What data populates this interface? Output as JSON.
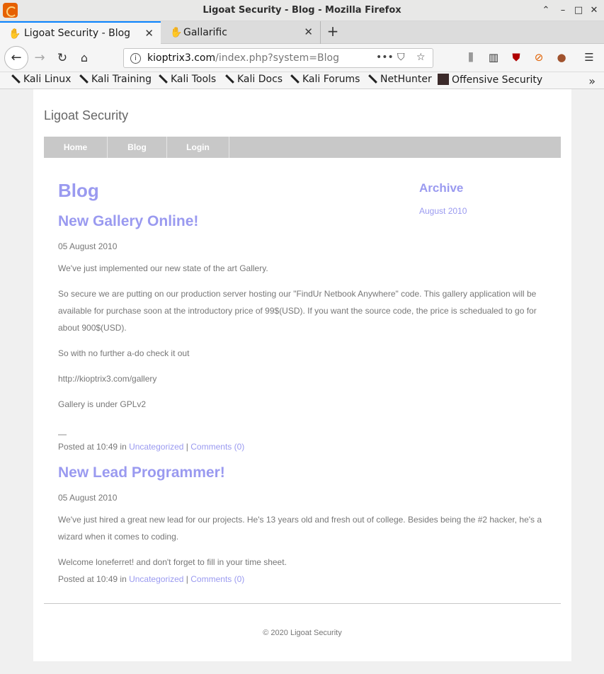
{
  "window": {
    "title": "Ligoat Security - Blog - Mozilla Firefox"
  },
  "tabs": [
    {
      "label": "Ligoat Security - Blog",
      "active": true
    },
    {
      "label": "Gallarific",
      "active": false
    }
  ],
  "urlbar": {
    "host": "kioptrix3.com",
    "path": "/index.php?system=Blog"
  },
  "bookmarks": [
    {
      "label": "Kali Linux"
    },
    {
      "label": "Kali Training"
    },
    {
      "label": "Kali Tools"
    },
    {
      "label": "Kali Docs"
    },
    {
      "label": "Kali Forums"
    },
    {
      "label": "NetHunter"
    },
    {
      "label": "Offensive Security"
    }
  ],
  "site": {
    "title": "Ligoat Security",
    "menu": [
      "Home",
      "Blog",
      "Login"
    ],
    "heading": "Blog",
    "archive_heading": "Archive",
    "archive_link": "August 2010",
    "footer": "© 2020 Ligoat Security"
  },
  "posts": [
    {
      "title": "New Gallery Online!",
      "date": "05 August 2010",
      "paragraphs": [
        "We've just implemented our new state of the art Gallery.",
        "So secure we are putting on our production server hosting our \"FindUr Netbook Anywhere\" code. This gallery application will be available for purchase soon at the introductory price of 99$(USD). If you want the source code, the price is schedualed to go for about 900$(USD).",
        "So with no further a-do check it out",
        "http://kioptrix3.com/gallery",
        "Gallery is under GPLv2",
        "—"
      ],
      "posted_prefix": "Posted at 10:49 in ",
      "category": "Uncategorized",
      "separator": " | ",
      "comments": "Comments (0)"
    },
    {
      "title": "New Lead Programmer!",
      "date": "05 August 2010",
      "paragraphs": [
        "We've just hired a great new lead for our projects. He's 13 years old and fresh out of college. Besides being the #2 hacker, he's a wizard when it comes to coding.",
        "Welcome loneferret! and don't forget to fill in your time sheet."
      ],
      "posted_prefix": "Posted at 10:49 in ",
      "category": "Uncategorized",
      "separator": " | ",
      "comments": "Comments (0)"
    }
  ]
}
